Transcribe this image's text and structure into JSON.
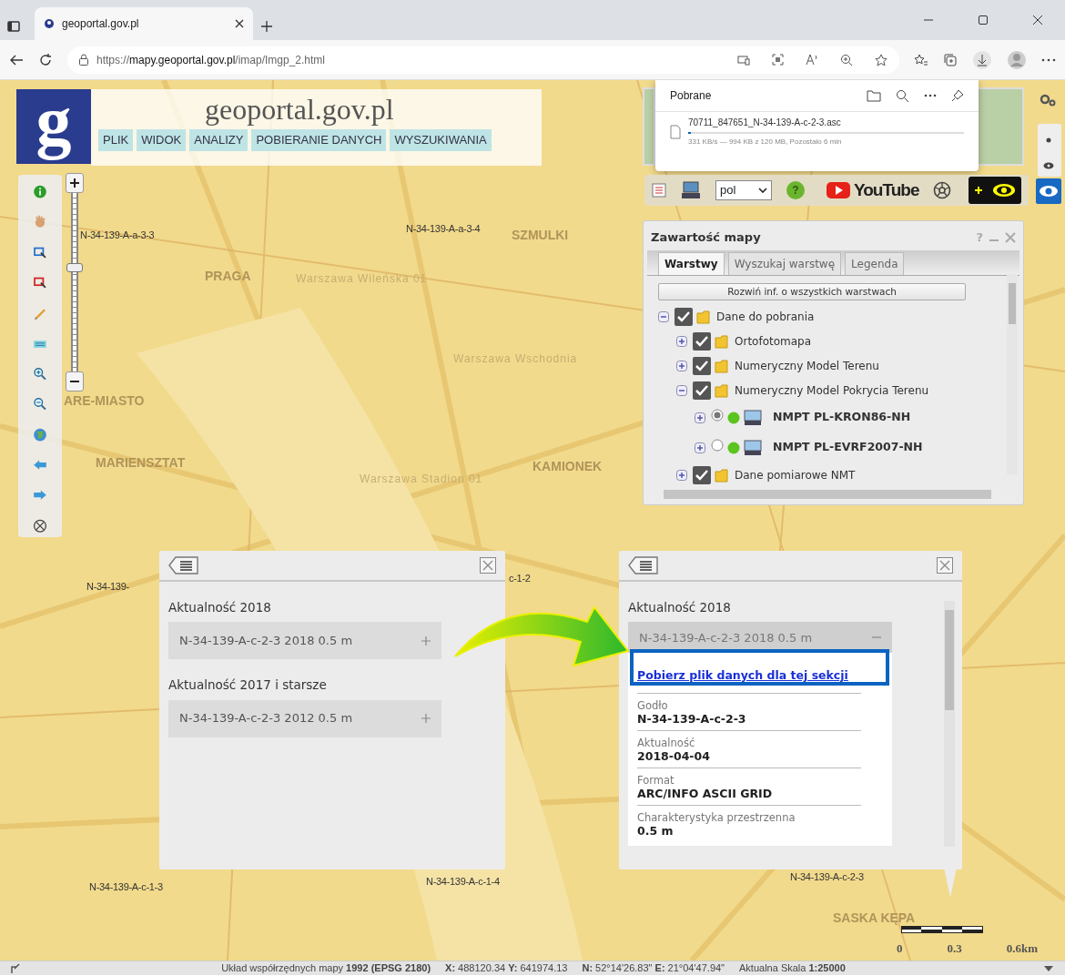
{
  "browser": {
    "tab_title": "geoportal.gov.pl",
    "url": "https://**mapy.geoportal.gov.pl**/imap/Imgp_2.html"
  },
  "header": {
    "logo_letter": "g",
    "title": "geoportal.gov.pl",
    "menu": [
      "PLIK",
      "WIDOK",
      "ANALIZY",
      "POBIERANIE DANYCH",
      "WYSZUKIWANIA"
    ]
  },
  "zoom_slider": {
    "level": 0.58
  },
  "downloads": {
    "title": "Pobrane",
    "file": "70711_847651_N-34-139-A-c-2-3.asc",
    "level": 0.01,
    "status": "331 KB/s — 994 KB z 120 MB, Pozostało 6 min"
  },
  "toolbar": {
    "language": "pol",
    "help": "?",
    "youtube": "YouTube"
  },
  "map_labels": [
    {
      "text": "N-34-139-A-a-3-3",
      "kind": "sheet"
    },
    {
      "text": "N-34-139-A-a-3-4",
      "kind": "sheet"
    },
    {
      "text": "SZMULKI",
      "kind": "district"
    },
    {
      "text": "PRAGA",
      "kind": "district"
    },
    {
      "text": "Warszawa Wileńska 01",
      "kind": "station"
    },
    {
      "text": "Warszawa Wschodnia",
      "kind": "station"
    },
    {
      "text": "ARE-MIASTO",
      "kind": "district"
    },
    {
      "text": "MARIENSZTAT",
      "kind": "district"
    },
    {
      "text": "Warszawa Stadion 01",
      "kind": "station"
    },
    {
      "text": "KAMIONEK",
      "kind": "district"
    },
    {
      "text": "N-34-139-",
      "kind": "sheet"
    },
    {
      "text": "c-1-2",
      "kind": "sheet"
    },
    {
      "text": "N-34-139-A-c-1-3",
      "kind": "sheet"
    },
    {
      "text": "N-34-139-A-c-1-4",
      "kind": "sheet"
    },
    {
      "text": "N-34-139-A-c-2-3",
      "kind": "sheet"
    },
    {
      "text": "SASKA KĘPA",
      "kind": "district"
    }
  ],
  "layers_panel": {
    "title": "Zawartość mapy",
    "help": "?",
    "tabs": [
      {
        "label": "Warstwy",
        "selected": true
      },
      {
        "label": "Wyszukaj warstwę",
        "selected": false
      },
      {
        "label": "Legenda",
        "selected": false
      }
    ],
    "expand_all": "Rozwiń inf. o wszystkich warstwach",
    "tree": [
      {
        "label": "Dane do pobrania",
        "kind": "folder",
        "checked": true,
        "expanded": true,
        "children": [
          {
            "label": "Ortofotomapa",
            "kind": "folder",
            "checked": true,
            "expanded": false
          },
          {
            "label": "Numeryczny Model Terenu",
            "kind": "folder",
            "checked": true,
            "expanded": false
          },
          {
            "label": "Numeryczny Model Pokrycia Terenu",
            "kind": "folder",
            "checked": true,
            "expanded": true,
            "children": [
              {
                "label": "NMPT PL-KRON86-NH",
                "kind": "layer",
                "selected": true,
                "expanded": false
              },
              {
                "label": "NMPT PL-EVRF2007-NH",
                "kind": "layer",
                "selected": false,
                "expanded": false
              }
            ]
          },
          {
            "label": "Dane pomiarowe NMT",
            "kind": "folder",
            "checked": true,
            "expanded": false
          }
        ]
      }
    ]
  },
  "section_panels": [
    {
      "groups": [
        {
          "heading": "Aktualność 2018",
          "items": [
            {
              "label": "N-34-139-A-c-2-3 2018 0.5 m",
              "expanded": false
            }
          ]
        },
        {
          "heading": "Aktualność 2017 i starsze",
          "items": [
            {
              "label": "N-34-139-A-c-2-3 2012 0.5 m",
              "expanded": false
            }
          ]
        }
      ]
    },
    {
      "groups": [
        {
          "heading": "Aktualność 2018",
          "items": [
            {
              "label": "N-34-139-A-c-2-3 2018 0.5 m",
              "expanded": true,
              "link": "Pobierz plik danych dla tej sekcji",
              "highlighted": true,
              "fields": [
                {
                  "label": "Godło",
                  "value": "N-34-139-A-c-2-3"
                },
                {
                  "label": "Aktualność",
                  "value": "2018-04-04"
                },
                {
                  "label": "Format",
                  "value": "ARC/INFO ASCII GRID"
                },
                {
                  "label": "Charakterystyka przestrzenna",
                  "value": "0.5 m"
                }
              ]
            }
          ]
        }
      ]
    }
  ],
  "scale_bar": {
    "ticks": [
      "0",
      "0.3",
      "0.6km"
    ]
  },
  "status_bar": {
    "parts": [
      "Układ współrzędnych mapy **1992 (EPSG 2180)**",
      "**X:** 488120.34 **Y:** 641974.13",
      "**N:** 52°14'26.83\" **E:** 21°04'47.94\"",
      "Aktualna Skala **1:25000**"
    ]
  }
}
